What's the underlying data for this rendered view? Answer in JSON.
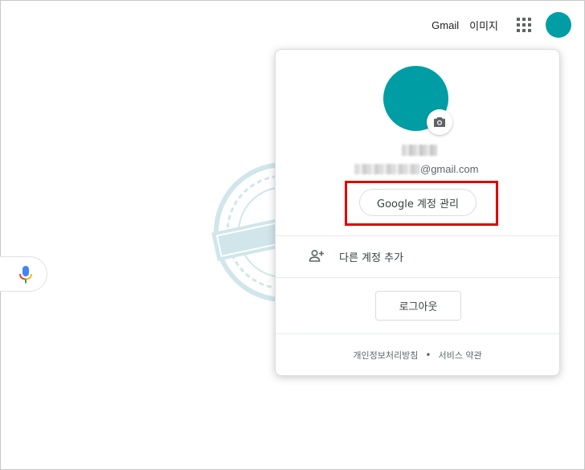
{
  "header": {
    "gmail_label": "Gmail",
    "images_label": "이미지"
  },
  "account": {
    "email_domain": "@gmail.com",
    "manage_label": "Google 계정 관리",
    "add_account_label": "다른 계정 추가",
    "logout_label": "로그아웃",
    "avatar_color": "#009da5"
  },
  "footer": {
    "privacy_label": "개인정보처리방침",
    "separator": "•",
    "terms_label": "서비스 약관"
  },
  "colors": {
    "highlight": "#e00000",
    "mic_blue": "#4285f4",
    "mic_red": "#ea4335",
    "mic_yellow": "#fbbc05",
    "mic_green": "#34a853"
  },
  "icons": {
    "apps": "apps-grid-icon",
    "camera": "camera-icon",
    "add_person": "add-person-icon",
    "mic": "microphone-icon"
  }
}
